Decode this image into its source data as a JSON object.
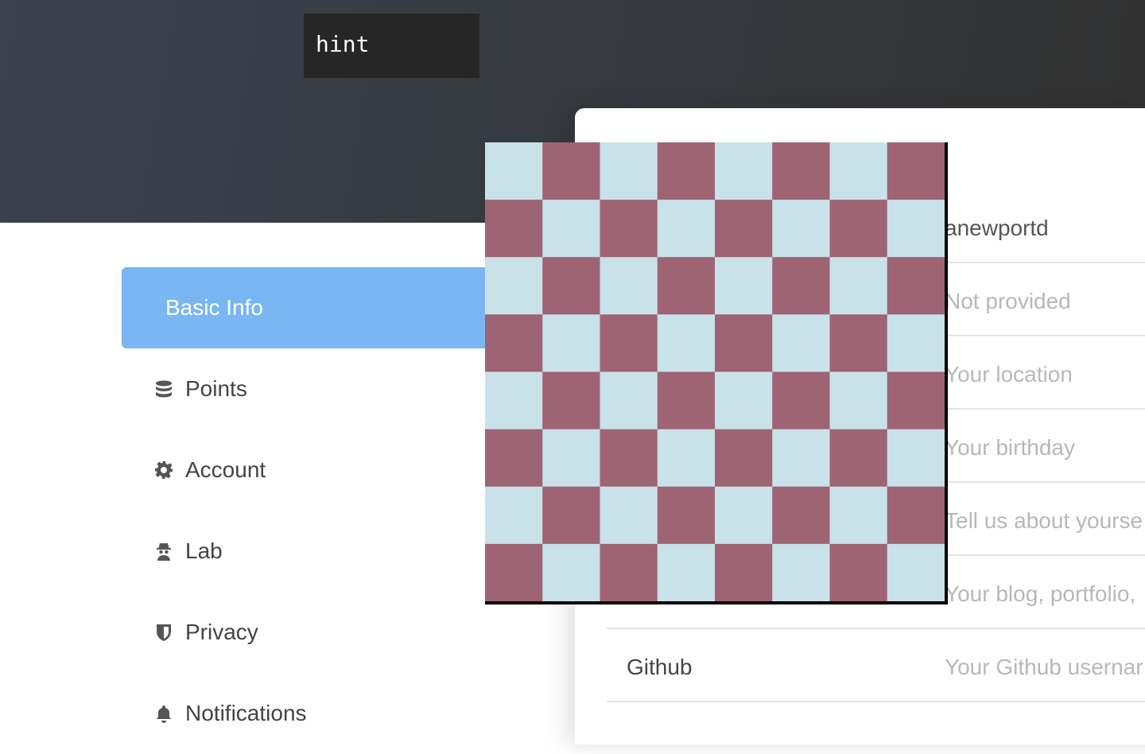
{
  "hint": {
    "label": "hint"
  },
  "sidebar": {
    "items": [
      {
        "label": "Basic Info",
        "icon": "",
        "active": true
      },
      {
        "label": "Points",
        "icon": "database-icon"
      },
      {
        "label": "Account",
        "icon": "gear-icon"
      },
      {
        "label": "Lab",
        "icon": "spy-icon"
      },
      {
        "label": "Privacy",
        "icon": "shield-icon"
      },
      {
        "label": "Notifications",
        "icon": "bell-icon"
      }
    ]
  },
  "profile": {
    "rows": [
      {
        "label": "",
        "value": "anewportd"
      },
      {
        "label": "",
        "value": "Not provided"
      },
      {
        "label": "",
        "value": "Your location"
      },
      {
        "label": "",
        "value": "Your birthday"
      },
      {
        "label": "",
        "value": "Tell us about yourse"
      },
      {
        "label": "",
        "value": "Your blog, portfolio,"
      },
      {
        "label": "Github",
        "value": "Your Github usernar"
      }
    ]
  },
  "checkerboard": {
    "rows": 8,
    "cols": 8,
    "light_color": "#c9e1e8",
    "dark_color": "#9e6473"
  }
}
